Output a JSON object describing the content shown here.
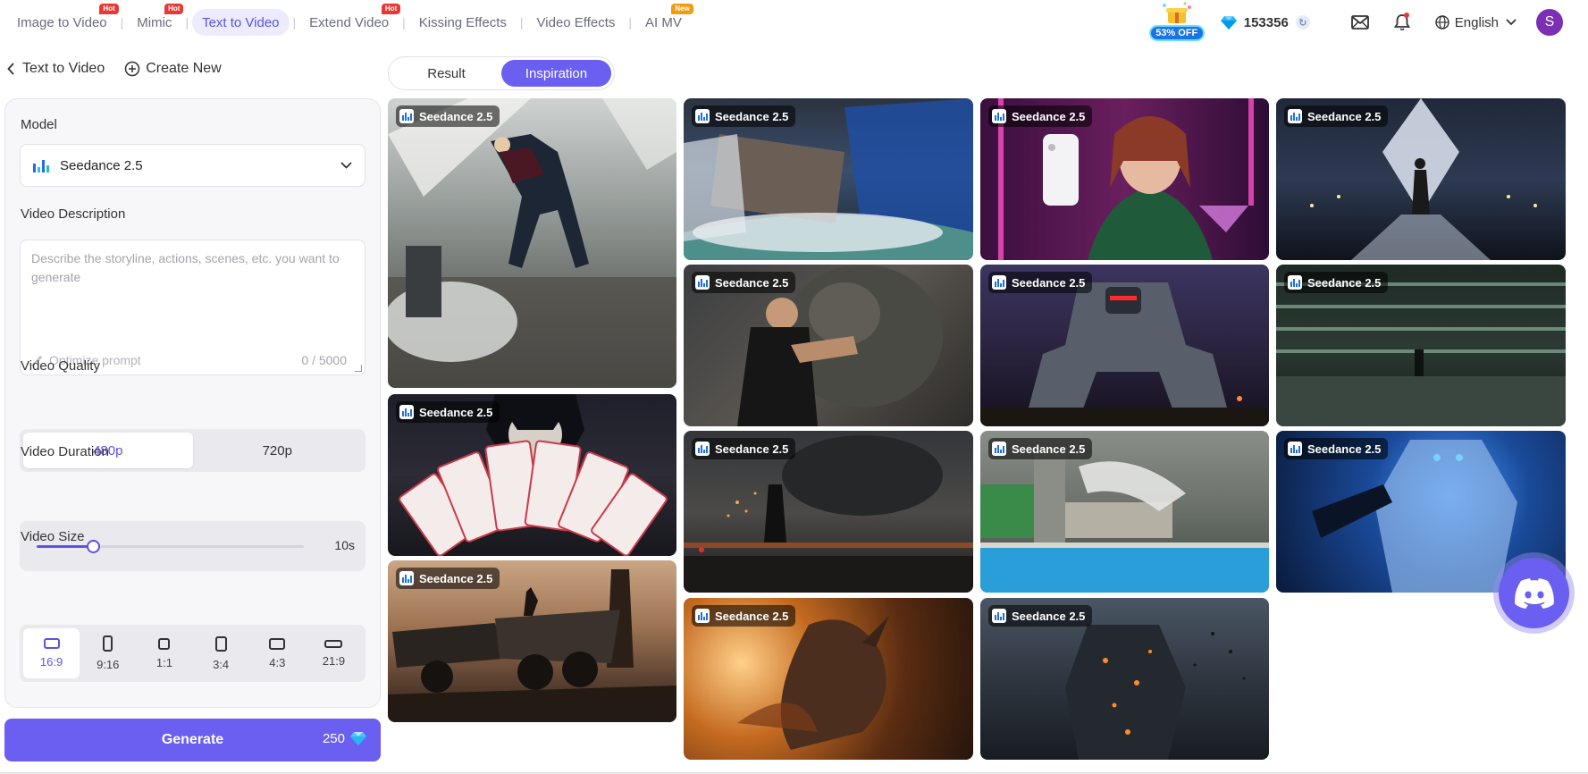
{
  "nav": {
    "tabs": [
      {
        "label": "Image to Video",
        "badge": "Hot"
      },
      {
        "label": "Mimic",
        "badge": "Hot"
      },
      {
        "label": "Text to Video",
        "badge": ""
      },
      {
        "label": "Extend Video",
        "badge": "Hot"
      },
      {
        "label": "Kissing Effects",
        "badge": ""
      },
      {
        "label": "Video Effects",
        "badge": ""
      },
      {
        "label": "AI MV",
        "badge": "New"
      }
    ],
    "active_tab": "Text to Video",
    "promo": "53% OFF",
    "credits": "153356",
    "language": "English",
    "avatar_initial": "S"
  },
  "page": {
    "back_label": "Text to Video",
    "create_label": "Create New"
  },
  "form": {
    "model_label": "Model",
    "model_value": "Seedance 2.5",
    "description_label": "Video Description",
    "description_placeholder": "Describe the storyline, actions, scenes, etc. you want to generate",
    "description_value": "",
    "optimize_label": "Optimize prompt",
    "counter": "0 / 5000",
    "quality_label": "Video Quality",
    "quality_options": [
      "480p",
      "720p"
    ],
    "quality_selected": "480p",
    "duration_label": "Video Duration",
    "duration_value": "10s",
    "duration_fraction": 0.21,
    "size_label": "Video Size",
    "size_options": [
      "16:9",
      "9:16",
      "1:1",
      "3:4",
      "4:3",
      "21:9"
    ],
    "size_selected": "16:9",
    "generate_label": "Generate",
    "generate_cost": "250"
  },
  "view_toggle": {
    "options": [
      "Result",
      "Inspiration"
    ],
    "selected": "Inspiration"
  },
  "gallery": {
    "items": [
      {
        "label": "Seedance 2.5",
        "scene": "woman leaping over subway turnstile"
      },
      {
        "label": "Seedance 2.5",
        "scene": "anime boy holding paper talismans"
      },
      {
        "label": "Seedance 2.5",
        "scene": "desert truck at sunset"
      },
      {
        "label": "Seedance 2.5",
        "scene": "ship crashing through studio water"
      },
      {
        "label": "Seedance 2.5",
        "scene": "man fighting a troll"
      },
      {
        "label": "Seedance 2.5",
        "scene": "figure leaping in industrial scene"
      },
      {
        "label": "Seedance 2.5",
        "scene": "dragon in fiery cave"
      },
      {
        "label": "Seedance 2.5",
        "scene": "woman holding phone in neon bar"
      },
      {
        "label": "Seedance 2.5",
        "scene": "giant mech robot"
      },
      {
        "label": "Seedance 2.5",
        "scene": "miniature city with pool"
      },
      {
        "label": "Seedance 2.5",
        "scene": "lava golem monster"
      },
      {
        "label": "Seedance 2.5",
        "scene": "runway model silhouette"
      },
      {
        "label": "Seedance 2.5",
        "scene": "multi-level green hall"
      },
      {
        "label": "Seedance 2.5",
        "scene": "blue ice giant battle"
      }
    ]
  },
  "colors": {
    "accent": "#6a5ff0",
    "accent_text": "#5b52e8",
    "hot_badge": "#e53935",
    "new_badge": "#f39c12"
  }
}
